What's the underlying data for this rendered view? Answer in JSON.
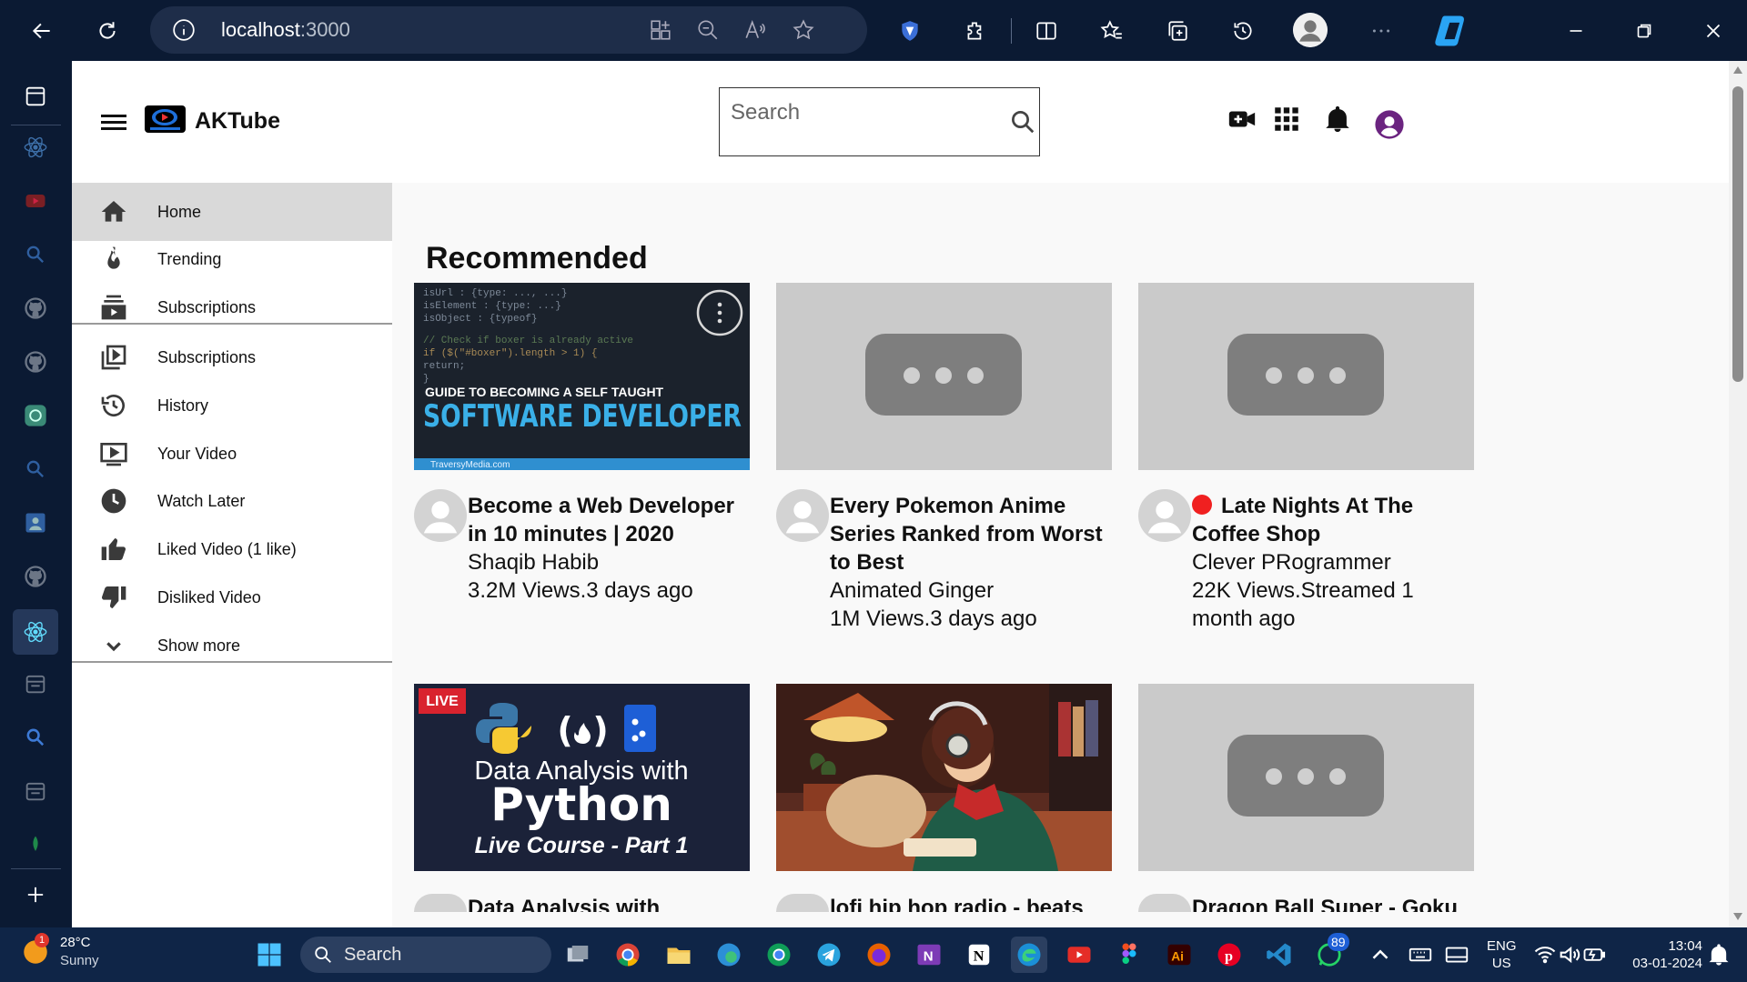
{
  "browser": {
    "url_host": "localhost",
    "url_port": ":3000"
  },
  "header": {
    "brand": "AKTube",
    "search_placeholder": "Search"
  },
  "nav": {
    "items": [
      {
        "label": "Home",
        "icon": "home-icon",
        "active": true
      },
      {
        "label": "Trending",
        "icon": "fire-icon"
      },
      {
        "label": "Subscriptions",
        "icon": "subscriptions-icon"
      },
      {
        "label": "Subscriptions",
        "icon": "video-library-icon"
      },
      {
        "label": "History",
        "icon": "history-icon"
      },
      {
        "label": "Your Video",
        "icon": "your-video-icon"
      },
      {
        "label": "Watch Later",
        "icon": "clock-icon"
      },
      {
        "label": "Liked Video (1 like)",
        "icon": "thumbs-up-icon"
      },
      {
        "label": "Disliked Video",
        "icon": "thumbs-down-icon"
      },
      {
        "label": "Show more",
        "icon": "chevron-down-icon"
      }
    ]
  },
  "main": {
    "section_title": "Recommended",
    "videos": [
      {
        "title": "Become a Web Developer in 10 minutes | 2020",
        "channel": "Shaqib Habib",
        "stats": "3.2M Views.3 days ago",
        "thumb": {
          "line1": "GUIDE TO BECOMING A SELF TAUGHT",
          "line2": "SOFTWARE DEVELOPER",
          "credit": "TraversyMedia.com"
        }
      },
      {
        "title": "Every Pokemon Anime Series Ranked from Worst to Best",
        "channel": "Animated Ginger",
        "stats": "1M Views.3 days ago"
      },
      {
        "title": "Late Nights At The Coffee Shop",
        "channel": "Clever PRogrammer",
        "stats": "22K Views.Streamed 1 month ago",
        "live": true
      },
      {
        "title": "Data Analysis with",
        "thumb": {
          "badge": "LIVE",
          "line1": "Data Analysis with",
          "line2": "Python",
          "line3": "Live Course - Part 1"
        }
      },
      {
        "title": "lofi hip hop radio - beats"
      },
      {
        "title": "Dragon Ball Super - Goku"
      }
    ]
  },
  "taskbar": {
    "weather_temp": "28°C",
    "weather_cond": "Sunny",
    "weather_badge": "1",
    "search_label": "Search",
    "whatsapp_badge": "89",
    "lang_top": "ENG",
    "lang_bottom": "US",
    "time": "13:04",
    "date": "03-01-2024"
  }
}
